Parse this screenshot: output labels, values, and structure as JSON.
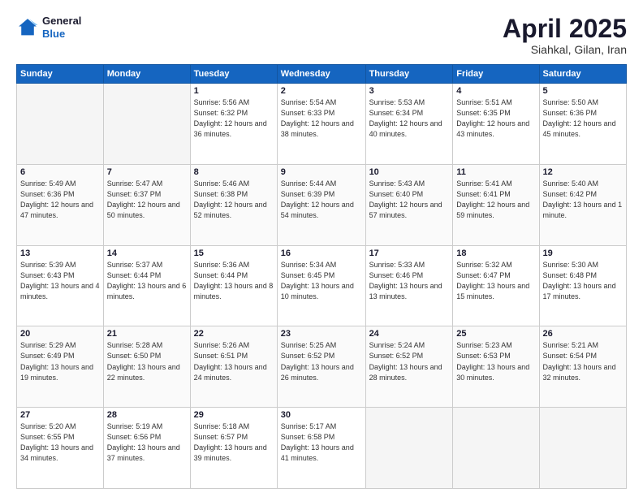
{
  "header": {
    "logo": {
      "general": "General",
      "blue": "Blue"
    },
    "title": "April 2025",
    "subtitle": "Siahkal, Gilan, Iran"
  },
  "weekdays": [
    "Sunday",
    "Monday",
    "Tuesday",
    "Wednesday",
    "Thursday",
    "Friday",
    "Saturday"
  ],
  "weeks": [
    [
      {
        "day": "",
        "empty": true
      },
      {
        "day": "",
        "empty": true
      },
      {
        "day": "1",
        "sunrise": "Sunrise: 5:56 AM",
        "sunset": "Sunset: 6:32 PM",
        "daylight": "Daylight: 12 hours and 36 minutes."
      },
      {
        "day": "2",
        "sunrise": "Sunrise: 5:54 AM",
        "sunset": "Sunset: 6:33 PM",
        "daylight": "Daylight: 12 hours and 38 minutes."
      },
      {
        "day": "3",
        "sunrise": "Sunrise: 5:53 AM",
        "sunset": "Sunset: 6:34 PM",
        "daylight": "Daylight: 12 hours and 40 minutes."
      },
      {
        "day": "4",
        "sunrise": "Sunrise: 5:51 AM",
        "sunset": "Sunset: 6:35 PM",
        "daylight": "Daylight: 12 hours and 43 minutes."
      },
      {
        "day": "5",
        "sunrise": "Sunrise: 5:50 AM",
        "sunset": "Sunset: 6:36 PM",
        "daylight": "Daylight: 12 hours and 45 minutes."
      }
    ],
    [
      {
        "day": "6",
        "sunrise": "Sunrise: 5:49 AM",
        "sunset": "Sunset: 6:36 PM",
        "daylight": "Daylight: 12 hours and 47 minutes."
      },
      {
        "day": "7",
        "sunrise": "Sunrise: 5:47 AM",
        "sunset": "Sunset: 6:37 PM",
        "daylight": "Daylight: 12 hours and 50 minutes."
      },
      {
        "day": "8",
        "sunrise": "Sunrise: 5:46 AM",
        "sunset": "Sunset: 6:38 PM",
        "daylight": "Daylight: 12 hours and 52 minutes."
      },
      {
        "day": "9",
        "sunrise": "Sunrise: 5:44 AM",
        "sunset": "Sunset: 6:39 PM",
        "daylight": "Daylight: 12 hours and 54 minutes."
      },
      {
        "day": "10",
        "sunrise": "Sunrise: 5:43 AM",
        "sunset": "Sunset: 6:40 PM",
        "daylight": "Daylight: 12 hours and 57 minutes."
      },
      {
        "day": "11",
        "sunrise": "Sunrise: 5:41 AM",
        "sunset": "Sunset: 6:41 PM",
        "daylight": "Daylight: 12 hours and 59 minutes."
      },
      {
        "day": "12",
        "sunrise": "Sunrise: 5:40 AM",
        "sunset": "Sunset: 6:42 PM",
        "daylight": "Daylight: 13 hours and 1 minute."
      }
    ],
    [
      {
        "day": "13",
        "sunrise": "Sunrise: 5:39 AM",
        "sunset": "Sunset: 6:43 PM",
        "daylight": "Daylight: 13 hours and 4 minutes."
      },
      {
        "day": "14",
        "sunrise": "Sunrise: 5:37 AM",
        "sunset": "Sunset: 6:44 PM",
        "daylight": "Daylight: 13 hours and 6 minutes."
      },
      {
        "day": "15",
        "sunrise": "Sunrise: 5:36 AM",
        "sunset": "Sunset: 6:44 PM",
        "daylight": "Daylight: 13 hours and 8 minutes."
      },
      {
        "day": "16",
        "sunrise": "Sunrise: 5:34 AM",
        "sunset": "Sunset: 6:45 PM",
        "daylight": "Daylight: 13 hours and 10 minutes."
      },
      {
        "day": "17",
        "sunrise": "Sunrise: 5:33 AM",
        "sunset": "Sunset: 6:46 PM",
        "daylight": "Daylight: 13 hours and 13 minutes."
      },
      {
        "day": "18",
        "sunrise": "Sunrise: 5:32 AM",
        "sunset": "Sunset: 6:47 PM",
        "daylight": "Daylight: 13 hours and 15 minutes."
      },
      {
        "day": "19",
        "sunrise": "Sunrise: 5:30 AM",
        "sunset": "Sunset: 6:48 PM",
        "daylight": "Daylight: 13 hours and 17 minutes."
      }
    ],
    [
      {
        "day": "20",
        "sunrise": "Sunrise: 5:29 AM",
        "sunset": "Sunset: 6:49 PM",
        "daylight": "Daylight: 13 hours and 19 minutes."
      },
      {
        "day": "21",
        "sunrise": "Sunrise: 5:28 AM",
        "sunset": "Sunset: 6:50 PM",
        "daylight": "Daylight: 13 hours and 22 minutes."
      },
      {
        "day": "22",
        "sunrise": "Sunrise: 5:26 AM",
        "sunset": "Sunset: 6:51 PM",
        "daylight": "Daylight: 13 hours and 24 minutes."
      },
      {
        "day": "23",
        "sunrise": "Sunrise: 5:25 AM",
        "sunset": "Sunset: 6:52 PM",
        "daylight": "Daylight: 13 hours and 26 minutes."
      },
      {
        "day": "24",
        "sunrise": "Sunrise: 5:24 AM",
        "sunset": "Sunset: 6:52 PM",
        "daylight": "Daylight: 13 hours and 28 minutes."
      },
      {
        "day": "25",
        "sunrise": "Sunrise: 5:23 AM",
        "sunset": "Sunset: 6:53 PM",
        "daylight": "Daylight: 13 hours and 30 minutes."
      },
      {
        "day": "26",
        "sunrise": "Sunrise: 5:21 AM",
        "sunset": "Sunset: 6:54 PM",
        "daylight": "Daylight: 13 hours and 32 minutes."
      }
    ],
    [
      {
        "day": "27",
        "sunrise": "Sunrise: 5:20 AM",
        "sunset": "Sunset: 6:55 PM",
        "daylight": "Daylight: 13 hours and 34 minutes."
      },
      {
        "day": "28",
        "sunrise": "Sunrise: 5:19 AM",
        "sunset": "Sunset: 6:56 PM",
        "daylight": "Daylight: 13 hours and 37 minutes."
      },
      {
        "day": "29",
        "sunrise": "Sunrise: 5:18 AM",
        "sunset": "Sunset: 6:57 PM",
        "daylight": "Daylight: 13 hours and 39 minutes."
      },
      {
        "day": "30",
        "sunrise": "Sunrise: 5:17 AM",
        "sunset": "Sunset: 6:58 PM",
        "daylight": "Daylight: 13 hours and 41 minutes."
      },
      {
        "day": "",
        "empty": true
      },
      {
        "day": "",
        "empty": true
      },
      {
        "day": "",
        "empty": true
      }
    ]
  ]
}
